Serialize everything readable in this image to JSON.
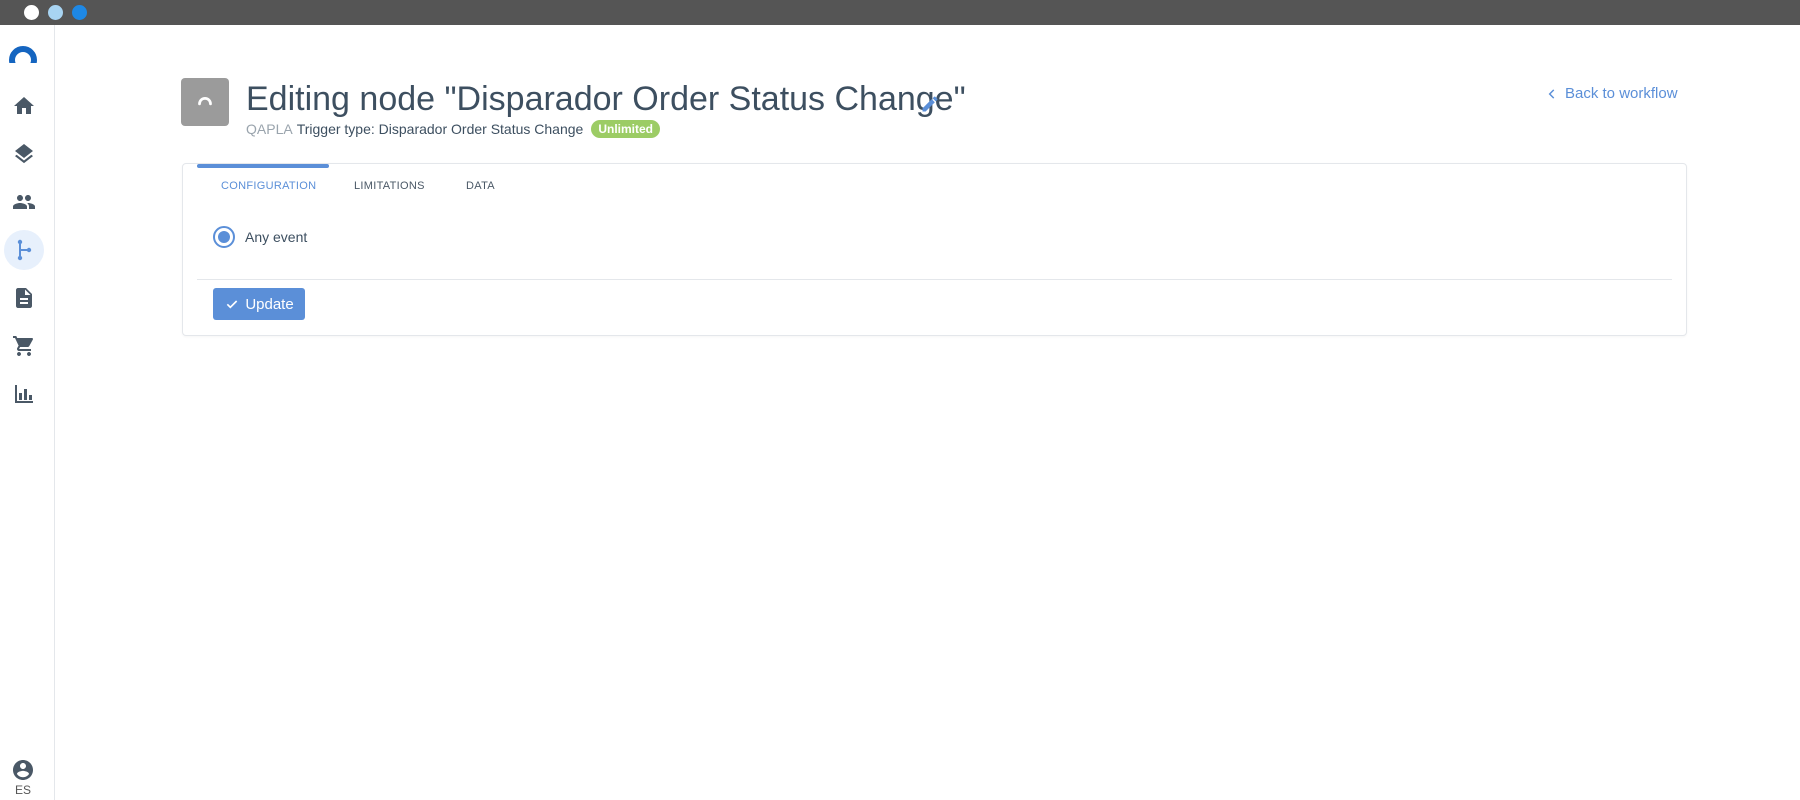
{
  "window": {
    "controls": [
      "close",
      "minimize",
      "maximize"
    ]
  },
  "sidebar": {
    "items": [
      {
        "icon": "home-icon",
        "active": false
      },
      {
        "icon": "layers-icon",
        "active": false
      },
      {
        "icon": "users-icon",
        "active": false
      },
      {
        "icon": "workflow-icon",
        "active": true
      },
      {
        "icon": "document-icon",
        "active": false
      },
      {
        "icon": "cart-icon",
        "active": false
      },
      {
        "icon": "bar-chart-icon",
        "active": false
      }
    ],
    "profile_icon": "account-circle-icon",
    "language": "ES"
  },
  "header": {
    "title": "Editing node \"Disparador Order Status Change\"",
    "brand": "QAPLA",
    "trigger_type": "Trigger type: Disparador Order Status Change",
    "badge": "Unlimited",
    "back_link": "Back to workflow"
  },
  "tabs": [
    {
      "label": "CONFIGURATION",
      "active": true
    },
    {
      "label": "LIMITATIONS",
      "active": false
    },
    {
      "label": "DATA",
      "active": false
    }
  ],
  "configuration": {
    "option_label": "Any event",
    "option_selected": true
  },
  "actions": {
    "update_label": "Update"
  },
  "colors": {
    "accent": "#5b8fd8",
    "badge": "#9ccc65",
    "titlebar": "#555555"
  }
}
